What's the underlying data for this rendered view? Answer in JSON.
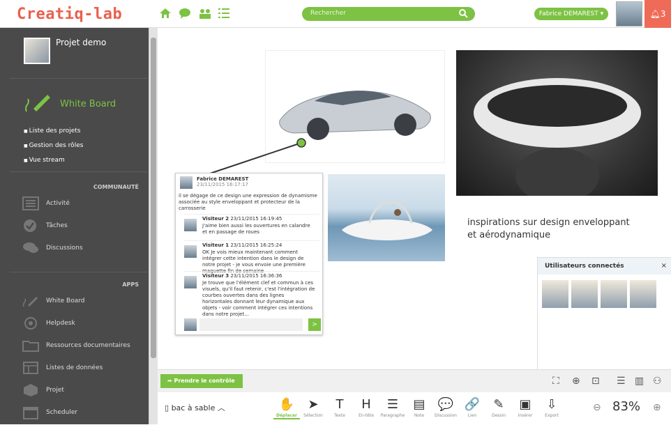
{
  "header": {
    "logo": "Creatiq-lab",
    "search_placeholder": "Rechercher",
    "user_name": "Fabrice DEMAREST ▾",
    "notifications": "3"
  },
  "sidebar": {
    "project_name": "Projet demo",
    "whiteboard_label": "White Board",
    "sublinks": [
      "Liste des projets",
      "Gestion des rôles",
      "Vue stream"
    ],
    "section_community": "COMMUNAUTÉ",
    "community_items": [
      "Activité",
      "Tâches",
      "Discussions"
    ],
    "section_apps": "APPS",
    "apps_items": [
      "White Board",
      "Helpdesk",
      "Ressources documentaires",
      "Listes de données",
      "Projet",
      "Scheduler"
    ]
  },
  "canvas": {
    "caption": "inspirations sur design enveloppant\net aérodynamique"
  },
  "comment_card": {
    "author": "Fabrice DEMAREST",
    "date": "23/11/2015 16:17:17",
    "description": "il se dégage de ce design une expression de dynamisme associée au style enveloppant et protecteur de la carrosserie",
    "comments": [
      {
        "author": "Visiteur 2",
        "date": "23/11/2015 16:19:45",
        "text": "J'aime bien aussi les ouvertures en calandre et en passage de roues"
      },
      {
        "author": "Visiteur 1",
        "date": "23/11/2015 16:25:24",
        "text": "OK Je vois mieux maintenant comment intégrer cette intention dans le design de notre projet - je vous envoie une première maquette fin de semaine"
      },
      {
        "author": "Visiteur 3",
        "date": "23/11/2015 16:36:36",
        "text": "Je trouve que l'élément clef et commun à ces visuels, qu'il faut retenir, c'est l'intégration de courbes ouvertes dans des lignes horizontales donnant leur dynamique aux objets - voir comment intégrer ces intentions dans notre projet..."
      }
    ],
    "send_label": ">"
  },
  "users_panel": {
    "title": "Utilisateurs connectés",
    "close": "×"
  },
  "bottombar": {
    "take_control": "Prendre le contrôle",
    "filename": "bac à sable",
    "tools": [
      {
        "glyph": "✋",
        "label": "Déplacer"
      },
      {
        "glyph": "➤",
        "label": "Sélection"
      },
      {
        "glyph": "T",
        "label": "Texte"
      },
      {
        "glyph": "H",
        "label": "En-tête"
      },
      {
        "glyph": "☰",
        "label": "Paragraphe"
      },
      {
        "glyph": "▤",
        "label": "Note"
      },
      {
        "glyph": "💬",
        "label": "Discussion"
      },
      {
        "glyph": "🔗",
        "label": "Lien"
      },
      {
        "glyph": "✎",
        "label": "Dessin"
      },
      {
        "glyph": "▣",
        "label": "Insérer"
      },
      {
        "glyph": "⇩",
        "label": "Export"
      }
    ],
    "zoom": "83%"
  },
  "colors": {
    "accent": "#7dc243",
    "logo": "#e9604e",
    "sidebar": "#4a4a4a",
    "notif": "#ef6b57"
  }
}
